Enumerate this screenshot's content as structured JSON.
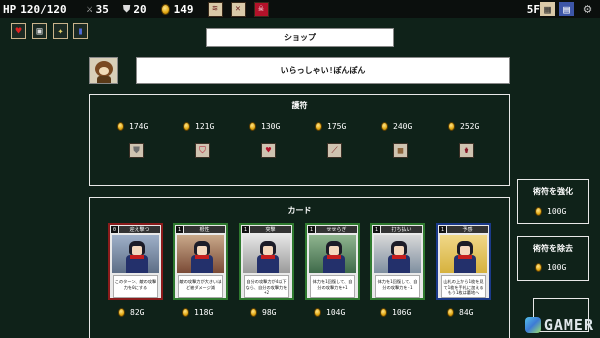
{
  "topbar": {
    "hp_label": "HP",
    "hp_value": "120/120",
    "attack": "35",
    "defense": "20",
    "gold": "149",
    "floor": "5F"
  },
  "header": {
    "title": "ショップ"
  },
  "merchant": {
    "greeting": "いらっしゃい!ぽんぽん"
  },
  "charms": {
    "title": "護符",
    "items": [
      {
        "price": "174G",
        "icon": "shield-charm"
      },
      {
        "price": "121G",
        "icon": "heart-shield-charm"
      },
      {
        "price": "130G",
        "icon": "heart-charm"
      },
      {
        "price": "175G",
        "icon": "sword-charm"
      },
      {
        "price": "240G",
        "icon": "scroll-charm"
      },
      {
        "price": "252G",
        "icon": "potion-charm"
      }
    ]
  },
  "cards": {
    "title": "カード",
    "items": [
      {
        "cost": "0",
        "name": "迎え撃つ",
        "desc": "このターン、敵の攻撃力を0にする",
        "price": "82G",
        "border": "#8a1b1b"
      },
      {
        "cost": "1",
        "name": "根性",
        "desc": "敵の攻撃力が大きいほど被ダメージ減",
        "price": "118G",
        "border": "#2f7a2f"
      },
      {
        "cost": "1",
        "name": "突撃",
        "desc": "自分の攻撃力が4以下なら、自分の攻撃力を+2",
        "price": "98G",
        "border": "#2f7a2f"
      },
      {
        "cost": "1",
        "name": "せせらぎ",
        "desc": "体力を1回復して、自分の攻撃力を+1",
        "price": "104G",
        "border": "#2f7a2f"
      },
      {
        "cost": "1",
        "name": "打ち払い",
        "desc": "体力を1回復して、自分の攻撃力を-1",
        "price": "106G",
        "border": "#2f7a2f"
      },
      {
        "cost": "1",
        "name": "予感",
        "desc": "山札の上から1枚を見て1枚を手札に加えるもう1枚は墓地へ",
        "price": "84G",
        "border": "#1b3a8a"
      }
    ]
  },
  "services": {
    "upgrade_label": "術符を強化",
    "upgrade_price": "100G",
    "remove_label": "術符を除去",
    "remove_price": "100G"
  },
  "watermark": "GAMER",
  "colors": {
    "background": "#0f2219",
    "gold": "#e2a812",
    "hp_red": "#c61e1e"
  }
}
